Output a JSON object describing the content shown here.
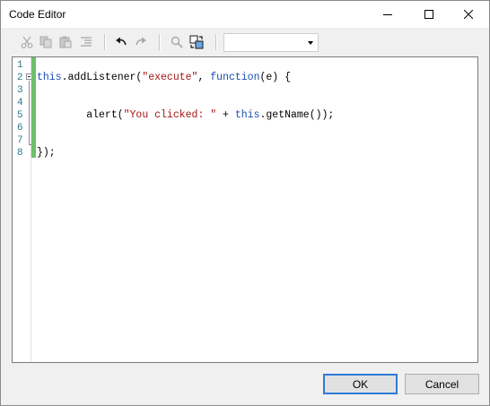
{
  "window": {
    "title": "Code Editor"
  },
  "toolbar": {
    "buttons": [
      {
        "name": "cut-icon",
        "enabled": false
      },
      {
        "name": "copy-icon",
        "enabled": false
      },
      {
        "name": "paste-icon",
        "enabled": false
      },
      {
        "name": "indent-icon",
        "enabled": false
      },
      {
        "name": "undo-icon",
        "enabled": true
      },
      {
        "name": "redo-icon",
        "enabled": false
      },
      {
        "name": "find-icon",
        "enabled": false
      },
      {
        "name": "replace-icon",
        "enabled": true
      }
    ],
    "combo_value": ""
  },
  "editor": {
    "line_numbers": [
      "1",
      "2",
      "3",
      "4",
      "5",
      "6",
      "7",
      "8"
    ],
    "lines": [
      [],
      [
        {
          "t": "this",
          "c": "kw"
        },
        {
          "t": ".addListener(",
          "c": ""
        },
        {
          "t": "\"execute\"",
          "c": "str"
        },
        {
          "t": ", ",
          "c": ""
        },
        {
          "t": "function",
          "c": "kw"
        },
        {
          "t": "(e) {",
          "c": ""
        }
      ],
      [],
      [],
      [
        {
          "t": "        alert(",
          "c": ""
        },
        {
          "t": "\"You clicked: \"",
          "c": "str"
        },
        {
          "t": " + ",
          "c": ""
        },
        {
          "t": "this",
          "c": "kw"
        },
        {
          "t": ".getName());",
          "c": ""
        }
      ],
      [],
      [],
      [
        {
          "t": "});",
          "c": ""
        }
      ]
    ],
    "colors": {
      "keyword": "#1b4fb0",
      "string": "#a31515",
      "line_number": "#2a7a8c",
      "change_bar": "#6fbf6a"
    }
  },
  "buttons": {
    "ok_label": "OK",
    "cancel_label": "Cancel"
  }
}
